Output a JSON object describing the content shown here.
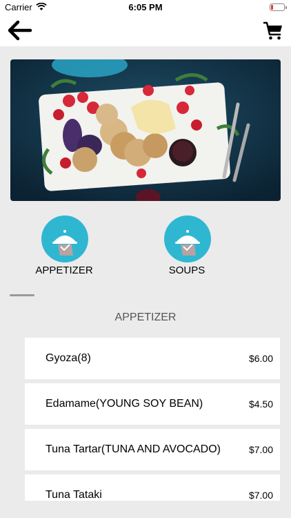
{
  "status": {
    "carrier": "Carrier",
    "time": "6:05 PM"
  },
  "nav": {
    "back_icon": "arrow-left-icon",
    "cart_icon": "cart-icon"
  },
  "categories": [
    {
      "label": "APPETIZER",
      "icon": "cloche-icon"
    },
    {
      "label": "SOUPS",
      "icon": "cloche-icon"
    }
  ],
  "section": {
    "title": "APPETIZER"
  },
  "items": [
    {
      "name": "Gyoza(8)",
      "price": "$6.00"
    },
    {
      "name": "Edamame(YOUNG SOY BEAN)",
      "price": "$4.50"
    },
    {
      "name": "Tuna Tartar(TUNA AND AVOCADO)",
      "price": "$7.00"
    },
    {
      "name": "Tuna Tataki",
      "price": "$7.00"
    }
  ],
  "colors": {
    "accent": "#2fb7d2",
    "background": "#ebebeb",
    "battery_low": "#e53935"
  }
}
